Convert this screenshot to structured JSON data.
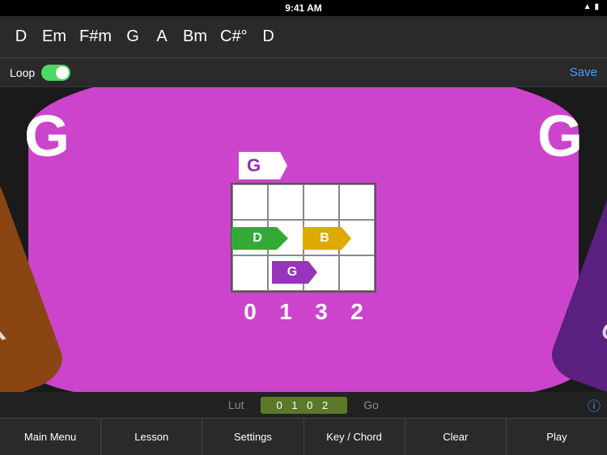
{
  "statusBar": {
    "time": "9:41 AM",
    "wifi": "wifi",
    "battery": "battery"
  },
  "chordBar": {
    "chords": [
      {
        "label": "D",
        "active": false
      },
      {
        "label": "Em",
        "active": false
      },
      {
        "label": "F#m",
        "active": false
      },
      {
        "label": "G",
        "active": false
      },
      {
        "label": "A",
        "active": false
      },
      {
        "label": "Bm",
        "active": false
      },
      {
        "label": "C#°",
        "active": false
      },
      {
        "label": "D",
        "active": false
      }
    ]
  },
  "controls": {
    "loopLabel": "Loop",
    "saveLabel": "Save"
  },
  "mainCard": {
    "leftLabel": "G",
    "rightLabel": "G",
    "leftSideLabel": "A",
    "rightSideLabel": "G",
    "chordFlag": "G",
    "noteD": "D",
    "noteB": "B",
    "noteG": "G",
    "fretNumbers": [
      "0",
      "1",
      "3",
      "2"
    ]
  },
  "miniBar": {
    "prev": "Lut",
    "current": "0 1 0 2",
    "next": "Go"
  },
  "infoButton": "ⓘ",
  "bottomNav": {
    "items": [
      {
        "label": "Main Menu",
        "active": false
      },
      {
        "label": "Lesson",
        "active": false
      },
      {
        "label": "Settings",
        "active": false
      },
      {
        "label": "Key / Chord",
        "active": false
      },
      {
        "label": "Clear",
        "active": false
      },
      {
        "label": "Play",
        "active": false
      }
    ]
  }
}
